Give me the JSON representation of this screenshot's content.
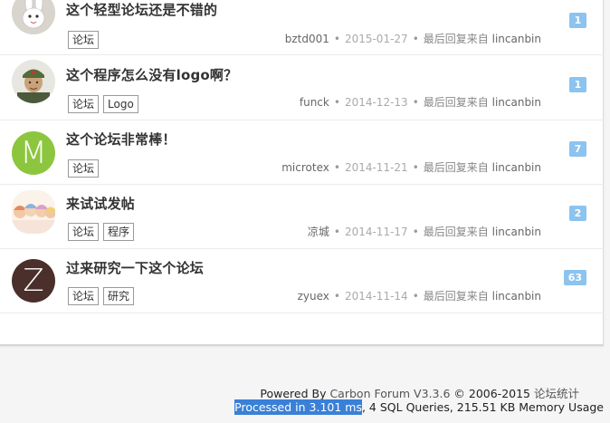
{
  "topics": [
    {
      "title": "这个轻型论坛还是不错的",
      "tags": [
        "论坛"
      ],
      "author": "bztd001",
      "date": "2015-01-27",
      "last_reply_prefix": "最后回复来自",
      "last_reply_user": "lincanbin",
      "reply_count": "1",
      "avatar": {
        "type": "image",
        "icon": "cartoon-rabbit-icon"
      }
    },
    {
      "title": "这个程序怎么没有logo啊？",
      "tags": [
        "论坛",
        "Logo"
      ],
      "author": "funck",
      "date": "2014-12-13",
      "last_reply_prefix": "最后回复来自",
      "last_reply_user": "lincanbin",
      "reply_count": "1",
      "avatar": {
        "type": "image",
        "icon": "soldier-portrait-icon"
      }
    },
    {
      "title": "这个论坛非常棒！",
      "tags": [
        "论坛"
      ],
      "author": "microtex",
      "date": "2014-11-21",
      "last_reply_prefix": "最后回复来自",
      "last_reply_user": "lincanbin",
      "reply_count": "7",
      "avatar": {
        "type": "letter",
        "letter": "M",
        "color": "#8cc63e"
      }
    },
    {
      "title": "来试试发帖",
      "tags": [
        "论坛",
        "程序"
      ],
      "author": "凉城",
      "date": "2014-11-17",
      "last_reply_prefix": "最后回复来自",
      "last_reply_user": "lincanbin",
      "reply_count": "2",
      "avatar": {
        "type": "image",
        "icon": "anime-group-icon"
      }
    },
    {
      "title": "过来研究一下这个论坛",
      "tags": [
        "论坛",
        "研究"
      ],
      "author": "zyuex",
      "date": "2014-11-14",
      "last_reply_prefix": "最后回复来自",
      "last_reply_user": "lincanbin",
      "reply_count": "63",
      "avatar": {
        "type": "letter",
        "letter": "Z",
        "color": "#4a2f2a"
      }
    }
  ],
  "footer": {
    "powered_prefix": "Powered By ",
    "powered_link": "Carbon Forum V3.3.6",
    "copyright": " © 2006-2015 ",
    "stats_link": "论坛统计",
    "processed_highlight": "Processed in 3.101 ms",
    "processed_rest": ", 4 SQL Queries, 215.51 KB Memory Usage"
  },
  "colors": {
    "count_badge": "#8cc3ef",
    "selection": "#3a80d7"
  }
}
